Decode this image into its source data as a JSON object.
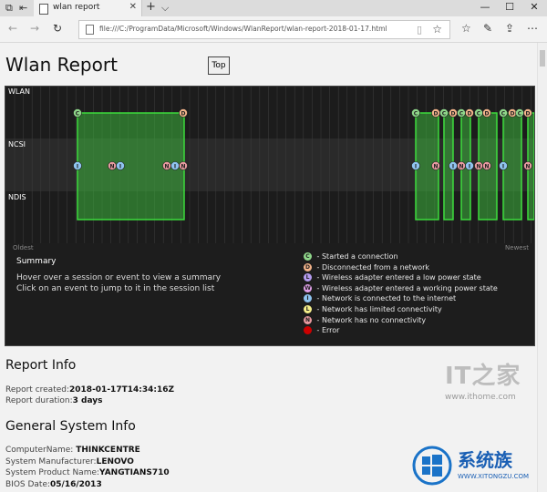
{
  "tab": {
    "title": "wlan report",
    "close": "✕",
    "new_tab": "+",
    "menu": "⌵"
  },
  "address": {
    "url": "file:///C:/ProgramData/Microsoft/Windows/WlanReport/wlan-report-2018-01-17.html"
  },
  "page": {
    "title": "Wlan Report",
    "top_button": "Top"
  },
  "viz": {
    "bands": [
      "WLAN",
      "NCSI",
      "NDIS"
    ],
    "axis_left": "Oldest",
    "axis_right": "Newest",
    "summary_title": "Summary",
    "summary_lines": [
      "Hover over a session or event to view a summary",
      "Click on an event to jump to it in the session list"
    ],
    "legend": [
      {
        "letter": "C",
        "color": "#8fd68a",
        "text": " - Started a connection"
      },
      {
        "letter": "D",
        "color": "#f2b38a",
        "text": " - Disconnected from a network"
      },
      {
        "letter": "L",
        "color": "#b59cf0",
        "text": " - Wireless adapter entered a low power state"
      },
      {
        "letter": "W",
        "color": "#e0a0e8",
        "text": " - Wireless adapter entered a working power state"
      },
      {
        "letter": "I",
        "color": "#8fc4f0",
        "text": " - Network is connected to the internet"
      },
      {
        "letter": "L",
        "color": "#f5ef8a",
        "text": " - Network has limited connectivity"
      },
      {
        "letter": "N",
        "color": "#e89aa0",
        "text": " - Network has no connectivity"
      },
      {
        "letter": "",
        "color": "#cc0000",
        "text": " - Error"
      }
    ]
  },
  "report_info": {
    "heading": "Report Info",
    "created_label": "Report created:",
    "created_value": "2018-01-17T14:34:16Z",
    "duration_label": "Report duration:",
    "duration_value": "3 days"
  },
  "system_info": {
    "heading": "General System Info",
    "computer_label": "ComputerName: ",
    "computer_value": "THINKCENTRE",
    "manufacturer_label": "System Manufacturer:",
    "manufacturer_value": "LENOVO",
    "product_label": "System Product Name:",
    "product_value": "YANGTIANS710",
    "bios_label": "BIOS Date:",
    "bios_value": "05/16/2013"
  },
  "watermarks": {
    "ithome_logo": "IT之家",
    "ithome_url": "www.ithome.com",
    "xitong_text": "系统族",
    "xitong_url": "WWW.XITONGZU.COM"
  }
}
